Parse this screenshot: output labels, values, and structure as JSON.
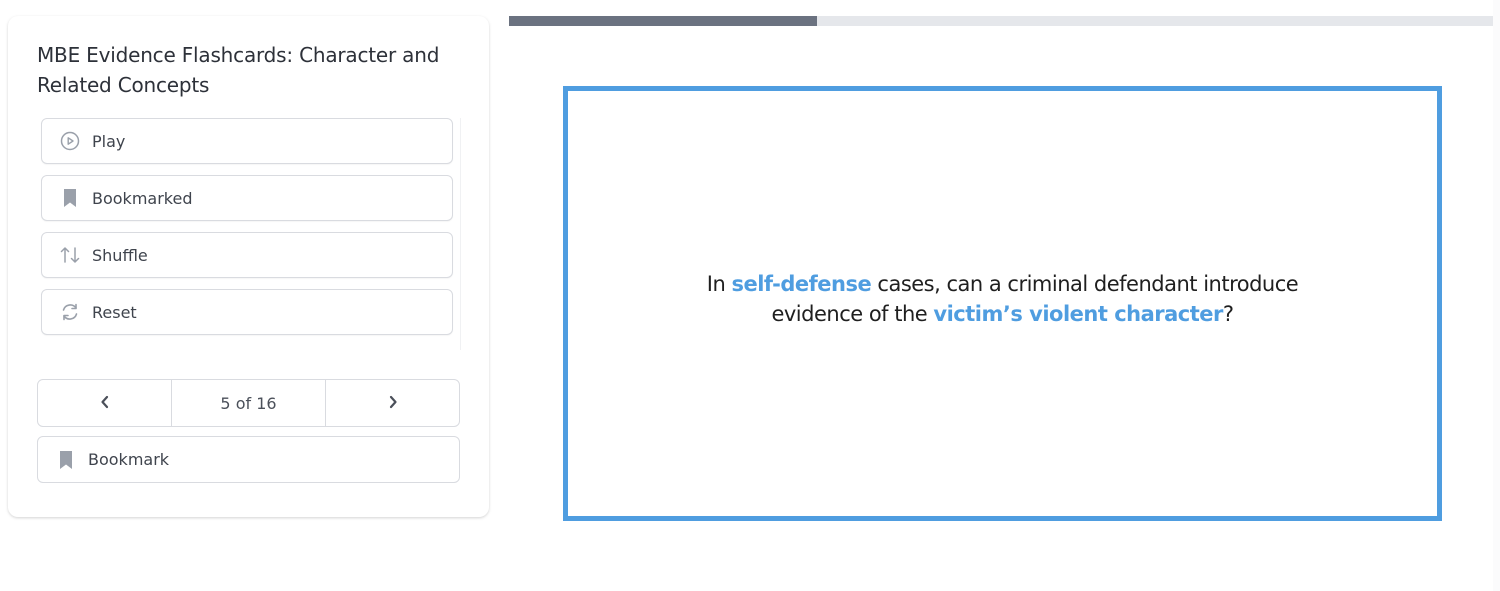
{
  "sidebar": {
    "title": "MBE Evidence Flashcards: Character and Related Concepts",
    "actions": [
      {
        "label": "Play",
        "icon": "play-circle-icon"
      },
      {
        "label": "Bookmarked",
        "icon": "bookmark-icon"
      },
      {
        "label": "Shuffle",
        "icon": "shuffle-arrows-icon"
      },
      {
        "label": "Reset",
        "icon": "reset-arrows-icon"
      }
    ],
    "pager": {
      "prev_icon": "chevron-left-icon",
      "current": "5",
      "separator": " of ",
      "total": "16",
      "next_icon": "chevron-right-icon"
    },
    "bookmark": {
      "label": "Bookmark",
      "icon": "bookmark-icon"
    }
  },
  "progress": {
    "value": 5,
    "max": 16,
    "fraction": 0.3125,
    "fill_color": "#6b7280",
    "track_color": "#e5e7eb"
  },
  "card": {
    "border_color": "#4f9de0",
    "highlight_color": "#4f9de0",
    "question_parts": [
      {
        "text": "In ",
        "highlight": false
      },
      {
        "text": "self-defense",
        "highlight": true
      },
      {
        "text": " cases, can a criminal defendant introduce evidence of the ",
        "highlight": false
      },
      {
        "text": "victim’s violent character",
        "highlight": true
      },
      {
        "text": "?",
        "highlight": false
      }
    ]
  }
}
